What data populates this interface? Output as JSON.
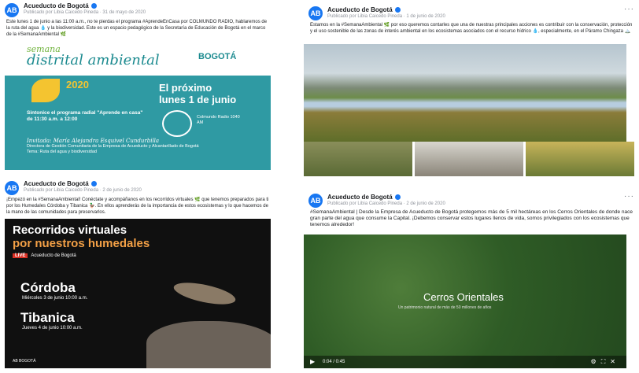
{
  "posts": [
    {
      "page_name": "Acueducto de Bogotá",
      "meta": "Publicado por Libia Caicedo Pineda · 31 de mayo de 2020",
      "text": "Este lunes 1 de junio a las 11:00 a.m., no te pierdas el programa #AprendeEnCasa por COLMUNDO RADIO, hablaremos de la ruta del agua 💧 y la biodiversidad. Este es un espacio pedagógico de la Secretaría de Educación de Bogotá en el marco de la #SemanaAmbiental 🌿",
      "image": {
        "semana": "semana",
        "distrital": "distrital",
        "ambiental": "ambiental",
        "year": "2020",
        "bogota": "BOGOTÁ",
        "headline_1": "El próximo",
        "headline_2": "lunes 1 de junio",
        "sintonice": "Sintonice el programa radial \"Aprende en casa\" de 11:30 a.m. a 12:00",
        "emisora": "Colmundo Radio 1040 AM",
        "invitada": "Invitada: María Alejandra Esquivel Cundurbilla",
        "cargo": "Directora de Gestión Comunitaria de la Empresa de Acueducto y Alcantarillado de Bogotá",
        "tema": "Tema: Ruta del agua y biodiversidad"
      }
    },
    {
      "page_name": "Acueducto de Bogotá",
      "meta": "Publicado por Libia Caicedo Pineda · 1 de junio de 2020",
      "text": "Estamos en la #SemanaAmbiental 🌿 por eso queremos contarles que una de nuestras principales acciones es contribuir con la conservación, protección y el uso sostenible de las zonas de interés ambiental en los ecosistemas asociados con el recurso hídrico 💧, especialmente, en el Páramo Chingaza 🏔️"
    },
    {
      "page_name": "Acueducto de Bogotá",
      "meta": "Publicado por Libia Caicedo Pineda · 2 de junio de 2020",
      "text": "¡Empezó en la #SemanaAmbiental! Conéctate y acompáñanos en los recorridos virtuales 🌿 que tenemos preparados para ti por los Humedales Córdoba y Tibanica 🦆. En ellos aprenderás de la importancia de estos ecosistemas y lo que hacemos de la mano de las comunidades para preservarlos.",
      "image": {
        "title_1": "Recorridos virtuales",
        "title_2": "por nuestros humedales",
        "live": "LIVE",
        "live_page": "Acueducto de Bogotá",
        "city_1": "Córdoba",
        "date_1": "Miércoles 3 de junio 10:00 a.m.",
        "city_2": "Tibanica",
        "date_2": "Jueves 4 de junio 10:00 a.m.",
        "logos": "AB   BOGOTÁ"
      }
    },
    {
      "page_name": "Acueducto de Bogotá",
      "meta": "Publicado por Libia Caicedo Pineda · 2 de junio de 2020",
      "text": "#SemanaAmbiental | Desde la Empresa de Acueducto de Bogotá protegemos más de 5 mil hectáreas en los Cerros Orientales de donde nace gran parte del agua que consume la Capital. ¡Debemos conservar estos lugares llenos de vida, somos privilegiados con los ecosistemas que tenemos alrededor!",
      "video": {
        "title": "Cerros Orientales",
        "subtitle": "Un patrimonio natural de más de 50 millones de años",
        "time": "0:04 / 0:45"
      }
    }
  ]
}
